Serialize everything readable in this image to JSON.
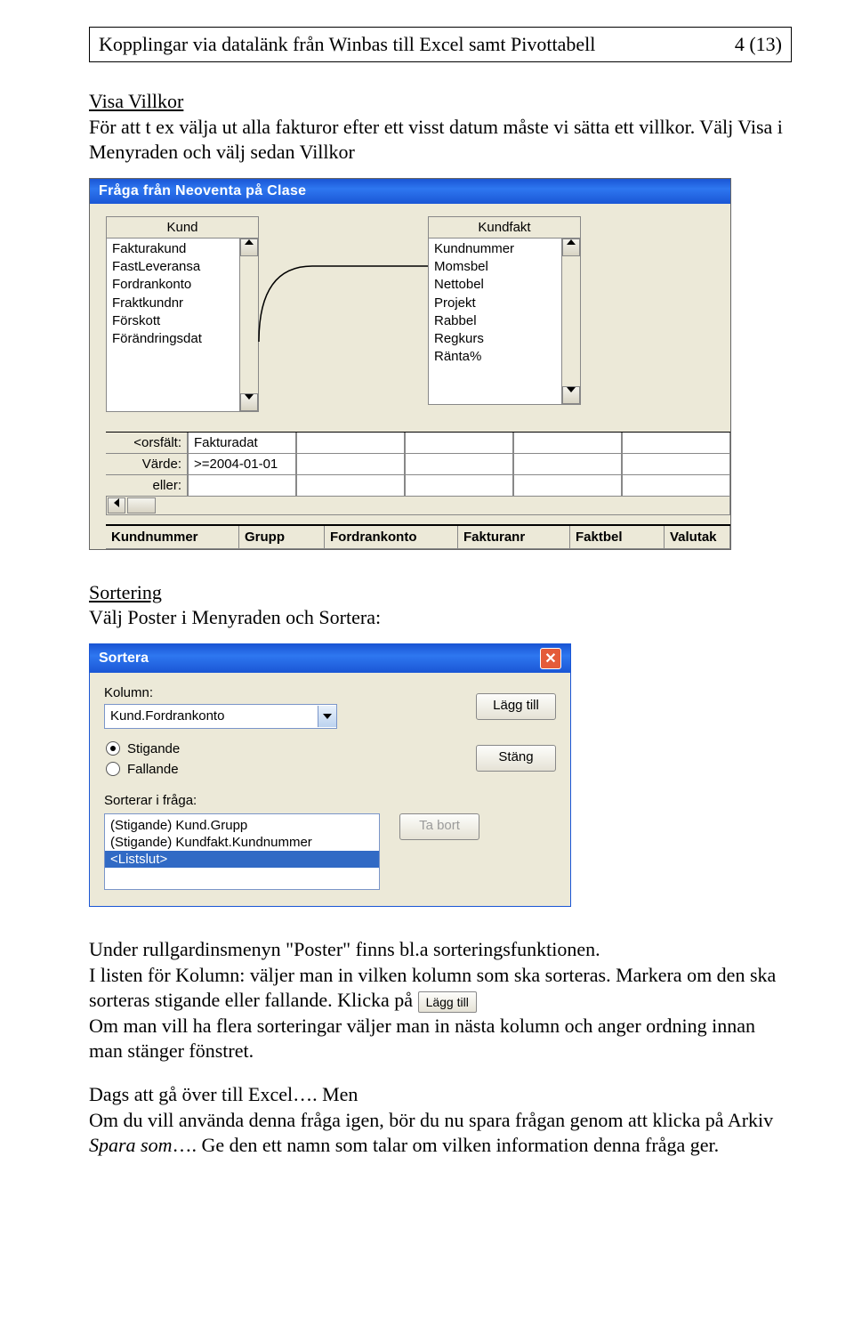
{
  "header": {
    "title": "Kopplingar via datalänk från Winbas till Excel samt Pivottabell",
    "page": "4 (13)"
  },
  "sec1": {
    "heading": "Visa Villkor",
    "p1": "För att  t ex välja ut alla fakturor efter ett visst datum måste vi sätta ett villkor. Välj Visa i",
    "p2": "Menyraden och välj sedan Villkor"
  },
  "query": {
    "title": "Fråga från Neoventa på Clase",
    "tbl1": {
      "name": "Kund",
      "items": [
        "Fakturakund",
        "FastLeveransa",
        "Fordrankonto",
        "Fraktkundnr",
        "Förskott",
        "Förändringsdat"
      ]
    },
    "tbl2": {
      "name": "Kundfakt",
      "items": [
        "Kundnummer",
        "Momsbel",
        "Nettobel",
        "Projekt",
        "Rabbel",
        "Regkurs",
        "Ränta%"
      ]
    },
    "crit": {
      "field_lbl": "<orsfält:",
      "value_lbl": "Värde:",
      "or_lbl": "eller:",
      "field": "Fakturadat",
      "value": ">=2004-01-01"
    },
    "cols": [
      "Kundnummer",
      "Grupp",
      "Fordrankonto",
      "Fakturanr",
      "Faktbel",
      "Valutak"
    ]
  },
  "sec2": {
    "heading": "Sortering",
    "p1": "Välj Poster i Menyraden och Sortera:"
  },
  "sort": {
    "title": "Sortera",
    "col_lbl": "Kolumn:",
    "col_val": "Kund.Fordrankonto",
    "add_btn": "Lägg till",
    "close_btn": "Stäng",
    "asc": "Stigande",
    "desc": "Fallande",
    "list_lbl": "Sorterar i fråga:",
    "list": [
      "(Stigande) Kund.Grupp",
      "(Stigande) Kundfakt.Kundnummer",
      "<Listslut>"
    ],
    "remove_btn": "Ta bort"
  },
  "sec3": {
    "p1a": "Under rullgardinsmenyn \"Poster\" finns bl.a sorteringsfunktionen.",
    "p2": "I listen för Kolumn: väljer man in vilken kolumn som ska sorteras. Markera om den ska",
    "p3a": "sorteras stigande eller fallande. Klicka på ",
    "lagg_btn": "Lägg till",
    "p4": "Om man vill ha flera sorteringar väljer man in nästa kolumn och anger ordning innan man stänger fönstret.",
    "p5a": "Dags att gå över till Excel…. Men",
    "p6a": "Om du vill använda denna fråga igen, bör du nu spara frågan genom att klicka på Arkiv ",
    "p6b": "Spara som",
    "p6c": "…. Ge den ett namn som talar om vilken information denna fråga ger."
  }
}
